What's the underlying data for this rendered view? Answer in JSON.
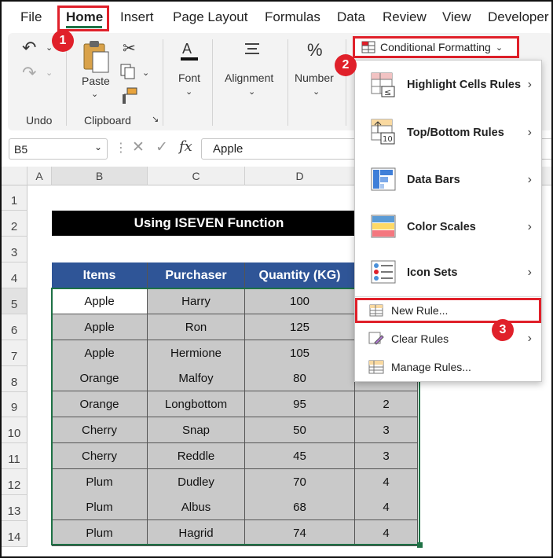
{
  "ribbon_tabs": [
    "File",
    "Home",
    "Insert",
    "Page Layout",
    "Formulas",
    "Data",
    "Review",
    "View",
    "Developer"
  ],
  "groups": {
    "undo_label": "Undo",
    "clipboard_label": "Clipboard",
    "paste_label": "Paste",
    "font_label": "Font",
    "alignment_label": "Alignment",
    "number_label": "Number"
  },
  "conditional_formatting": {
    "button_label": "Conditional Formatting",
    "menu_items": [
      "Highlight Cells Rules",
      "Top/Bottom Rules",
      "Data Bars",
      "Color Scales",
      "Icon Sets",
      "New Rule...",
      "Clear Rules",
      "Manage Rules..."
    ]
  },
  "formula_bar": {
    "name_box": "B5",
    "fx_symbol": "fx",
    "value": "Apple"
  },
  "columns": [
    "A",
    "B",
    "C",
    "D"
  ],
  "rows": [
    "1",
    "2",
    "3",
    "4",
    "5",
    "6",
    "7",
    "8",
    "9",
    "10",
    "11",
    "12",
    "13",
    "14"
  ],
  "sheet": {
    "title": "Using ISEVEN Function",
    "headers": [
      "Items",
      "Purchaser",
      "Quantity (KG)"
    ],
    "data": [
      [
        "Apple",
        "Harry",
        "100",
        ""
      ],
      [
        "Apple",
        "Ron",
        "125",
        ""
      ],
      [
        "Apple",
        "Hermione",
        "105",
        ""
      ],
      [
        "Orange",
        "Malfoy",
        "80",
        ""
      ],
      [
        "Orange",
        "Longbottom",
        "95",
        "2"
      ],
      [
        "Cherry",
        "Snap",
        "50",
        "3"
      ],
      [
        "Cherry",
        "Reddle",
        "45",
        "3"
      ],
      [
        "Plum",
        "Dudley",
        "70",
        "4"
      ],
      [
        "Plum",
        "Albus",
        "68",
        "4"
      ],
      [
        "Plum",
        "Hagrid",
        "74",
        "4"
      ]
    ]
  },
  "badges": [
    "1",
    "2",
    "3"
  ],
  "colors": {
    "header_blue": "#2f5597",
    "cell_gray": "#c9c9c9",
    "highlight_red": "#e0202a",
    "excel_green": "#1e7145"
  }
}
